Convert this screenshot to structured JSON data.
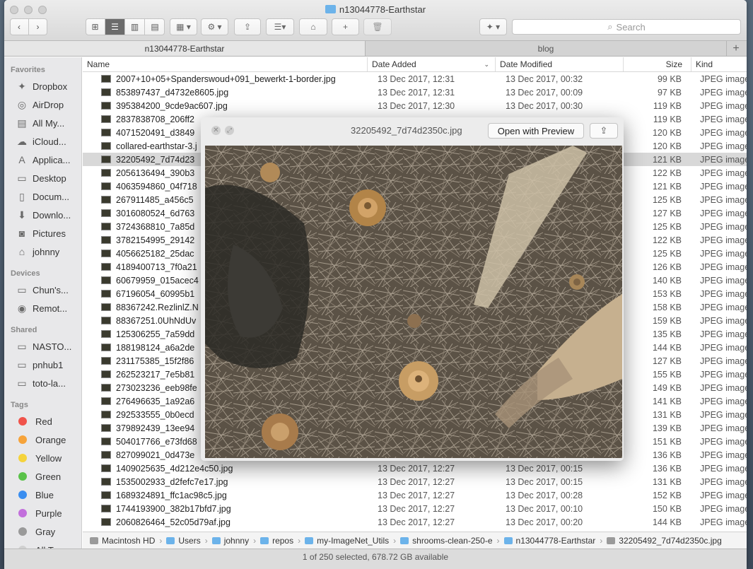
{
  "window": {
    "title": "n13044778-Earthstar"
  },
  "toolbar": {
    "view_modes": [
      "⊞",
      "☰",
      "▥",
      "▤"
    ],
    "arrange_label": "▦ ▾",
    "action_label": "⚙ ▾",
    "share_label": "⇪",
    "edit_tags_label": "⌂",
    "new_folder_label": "+",
    "trash_label": "🗑",
    "dropbox_label": "✦ ▾",
    "search_placeholder": "Search"
  },
  "tabs": [
    {
      "label": "n13044778-Earthstar"
    },
    {
      "label": "blog"
    }
  ],
  "sidebar": {
    "favorites_header": "Favorites",
    "favorites": [
      "Dropbox",
      "AirDrop",
      "All My...",
      "iCloud...",
      "Applica...",
      "Desktop",
      "Docum...",
      "Downlo...",
      "Pictures",
      "johnny"
    ],
    "devices_header": "Devices",
    "devices": [
      "Chun's...",
      "Remot..."
    ],
    "shared_header": "Shared",
    "shared": [
      "NASTO...",
      "pnhub1",
      "toto-la..."
    ],
    "tags_header": "Tags",
    "tags": [
      {
        "label": "Red",
        "color": "#f0534b"
      },
      {
        "label": "Orange",
        "color": "#f6a33a"
      },
      {
        "label": "Yellow",
        "color": "#f5d33c"
      },
      {
        "label": "Green",
        "color": "#5ac24a"
      },
      {
        "label": "Blue",
        "color": "#3a8ef0"
      },
      {
        "label": "Purple",
        "color": "#c26fdc"
      },
      {
        "label": "Gray",
        "color": "#9a9a9a"
      },
      {
        "label": "All Tag...",
        "color": "#d0d0d0"
      }
    ]
  },
  "columns": {
    "name": "Name",
    "date_added": "Date Added",
    "date_modified": "Date Modified",
    "size": "Size",
    "kind": "Kind"
  },
  "files": [
    {
      "name": "2007+10+05+Spanderswoud+091_bewerkt-1-border.jpg",
      "added": "13 Dec 2017, 12:31",
      "modified": "13 Dec 2017, 00:32",
      "size": "99 KB",
      "kind": "JPEG image"
    },
    {
      "name": "853897437_d4732e8605.jpg",
      "added": "13 Dec 2017, 12:31",
      "modified": "13 Dec 2017, 00:09",
      "size": "97 KB",
      "kind": "JPEG image"
    },
    {
      "name": "395384200_9cde9ac607.jpg",
      "added": "13 Dec 2017, 12:30",
      "modified": "13 Dec 2017, 00:30",
      "size": "119 KB",
      "kind": "JPEG image"
    },
    {
      "name": "2837838708_206ff2",
      "added": "",
      "modified": "",
      "size": "119 KB",
      "kind": "JPEG image"
    },
    {
      "name": "4071520491_d3849",
      "added": "",
      "modified": "",
      "size": "120 KB",
      "kind": "JPEG image"
    },
    {
      "name": "collared-earthstar-3.j",
      "added": "",
      "modified": "",
      "size": "120 KB",
      "kind": "JPEG image"
    },
    {
      "name": "32205492_7d74d23",
      "added": "",
      "modified": "",
      "size": "121 KB",
      "kind": "JPEG image",
      "selected": true
    },
    {
      "name": "2056136494_390b3",
      "added": "",
      "modified": "",
      "size": "122 KB",
      "kind": "JPEG image"
    },
    {
      "name": "4063594860_04f718",
      "added": "",
      "modified": "",
      "size": "121 KB",
      "kind": "JPEG image"
    },
    {
      "name": "267911485_a456c5",
      "added": "",
      "modified": "",
      "size": "125 KB",
      "kind": "JPEG image"
    },
    {
      "name": "3016080524_6d763",
      "added": "",
      "modified": "",
      "size": "127 KB",
      "kind": "JPEG image"
    },
    {
      "name": "3724368810_7a85d",
      "added": "",
      "modified": "",
      "size": "125 KB",
      "kind": "JPEG image"
    },
    {
      "name": "3782154995_29142",
      "added": "",
      "modified": "",
      "size": "122 KB",
      "kind": "JPEG image"
    },
    {
      "name": "4056625182_25dac",
      "added": "",
      "modified": "",
      "size": "125 KB",
      "kind": "JPEG image"
    },
    {
      "name": "4189400713_7f0a21",
      "added": "",
      "modified": "",
      "size": "126 KB",
      "kind": "JPEG image"
    },
    {
      "name": "60679959_015acec4",
      "added": "",
      "modified": "",
      "size": "140 KB",
      "kind": "JPEG image"
    },
    {
      "name": "67196054_60995b1",
      "added": "",
      "modified": "",
      "size": "153 KB",
      "kind": "JPEG image"
    },
    {
      "name": "88367242.RezlinlZ.N",
      "added": "",
      "modified": "",
      "size": "158 KB",
      "kind": "JPEG image"
    },
    {
      "name": "88367251.0UhNdUv",
      "added": "",
      "modified": "",
      "size": "159 KB",
      "kind": "JPEG image"
    },
    {
      "name": "125306255_7a59dd",
      "added": "",
      "modified": "",
      "size": "135 KB",
      "kind": "JPEG image"
    },
    {
      "name": "188198124_a6a2de",
      "added": "",
      "modified": "",
      "size": "144 KB",
      "kind": "JPEG image"
    },
    {
      "name": "231175385_15f2f86",
      "added": "",
      "modified": "",
      "size": "127 KB",
      "kind": "JPEG image"
    },
    {
      "name": "262523217_7e5b81",
      "added": "",
      "modified": "",
      "size": "155 KB",
      "kind": "JPEG image"
    },
    {
      "name": "273023236_eeb98fe",
      "added": "",
      "modified": "",
      "size": "149 KB",
      "kind": "JPEG image"
    },
    {
      "name": "276496635_1a92a6",
      "added": "",
      "modified": "",
      "size": "141 KB",
      "kind": "JPEG image"
    },
    {
      "name": "292533555_0b0ecd",
      "added": "",
      "modified": "",
      "size": "131 KB",
      "kind": "JPEG image"
    },
    {
      "name": "379892439_13ee94",
      "added": "",
      "modified": "",
      "size": "139 KB",
      "kind": "JPEG image"
    },
    {
      "name": "504017766_e73fd68",
      "added": "",
      "modified": "",
      "size": "151 KB",
      "kind": "JPEG image"
    },
    {
      "name": "827099021_0d473e",
      "added": "",
      "modified": "",
      "size": "136 KB",
      "kind": "JPEG image"
    },
    {
      "name": "1409025635_4d212e4c50.jpg",
      "added": "13 Dec 2017, 12:27",
      "modified": "13 Dec 2017, 00:15",
      "size": "136 KB",
      "kind": "JPEG image"
    },
    {
      "name": "1535002933_d2fefc7e17.jpg",
      "added": "13 Dec 2017, 12:27",
      "modified": "13 Dec 2017, 00:15",
      "size": "131 KB",
      "kind": "JPEG image"
    },
    {
      "name": "1689324891_ffc1ac98c5.jpg",
      "added": "13 Dec 2017, 12:27",
      "modified": "13 Dec 2017, 00:28",
      "size": "152 KB",
      "kind": "JPEG image"
    },
    {
      "name": "1744193900_382b17bfd7.jpg",
      "added": "13 Dec 2017, 12:27",
      "modified": "13 Dec 2017, 00:10",
      "size": "150 KB",
      "kind": "JPEG image"
    },
    {
      "name": "2060826464_52c05d79af.jpg",
      "added": "13 Dec 2017, 12:27",
      "modified": "13 Dec 2017, 00:20",
      "size": "144 KB",
      "kind": "JPEG image"
    }
  ],
  "pathbar": [
    "Macintosh HD",
    "Users",
    "johnny",
    "repos",
    "my-ImageNet_Utils",
    "shrooms-clean-250-e",
    "n13044778-Earthstar",
    "32205492_7d74d2350c.jpg"
  ],
  "status": "1 of 250 selected, 678.72 GB available",
  "quicklook": {
    "title": "32205492_7d74d2350c.jpg",
    "open_label": "Open with Preview",
    "share_label": "⇪"
  }
}
